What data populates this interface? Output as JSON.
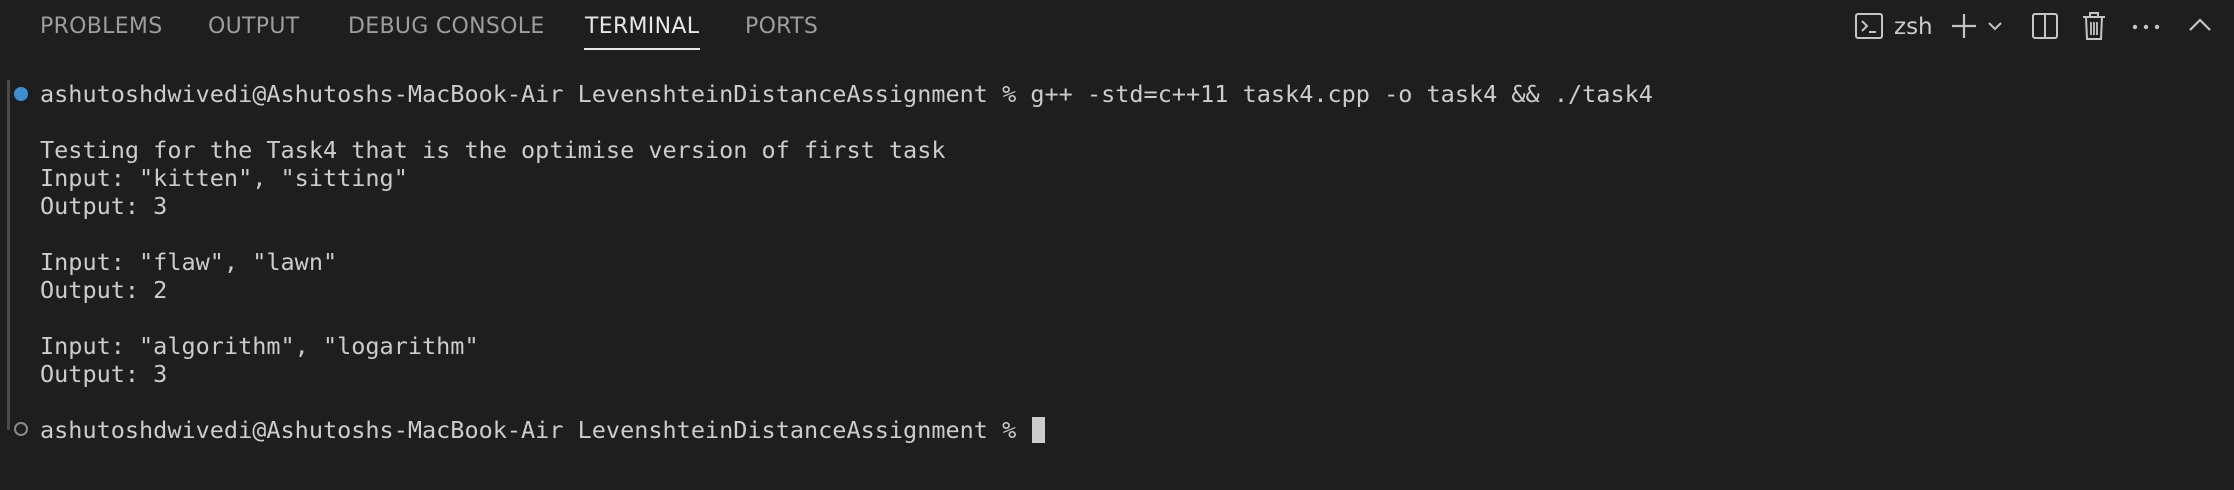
{
  "panel": {
    "tabs": [
      {
        "label": "PROBLEMS",
        "active": false
      },
      {
        "label": "OUTPUT",
        "active": false
      },
      {
        "label": "DEBUG CONSOLE",
        "active": false
      },
      {
        "label": "TERMINAL",
        "active": true
      },
      {
        "label": "PORTS",
        "active": false
      }
    ],
    "toolbar": {
      "shell_name": "zsh",
      "icons": [
        "terminal-icon",
        "plus-icon",
        "chevron-down-icon",
        "split-icon",
        "trash-icon",
        "ellipsis-icon",
        "chevron-up-icon"
      ]
    }
  },
  "terminal": {
    "lines": [
      "ashutoshdwivedi@Ashutoshs-MacBook-Air LevenshteinDistanceAssignment % g++ -std=c++11 task4.cpp -o task4 && ./task4",
      "",
      "Testing for the Task4 that is the optimise version of first task",
      "Input: \"kitten\", \"sitting\"",
      "Output: 3",
      "",
      "Input: \"flaw\", \"lawn\"",
      "Output: 2",
      "",
      "Input: \"algorithm\", \"logarithm\"",
      "Output: 3",
      "",
      "ashutoshdwivedi@Ashutoshs-MacBook-Air LevenshteinDistanceAssignment % "
    ],
    "colors": {
      "background": "#1e1e1e",
      "foreground": "#cccccc",
      "success_dot": "#3e8fd0",
      "pending_dot": "#8a8a8a"
    }
  }
}
